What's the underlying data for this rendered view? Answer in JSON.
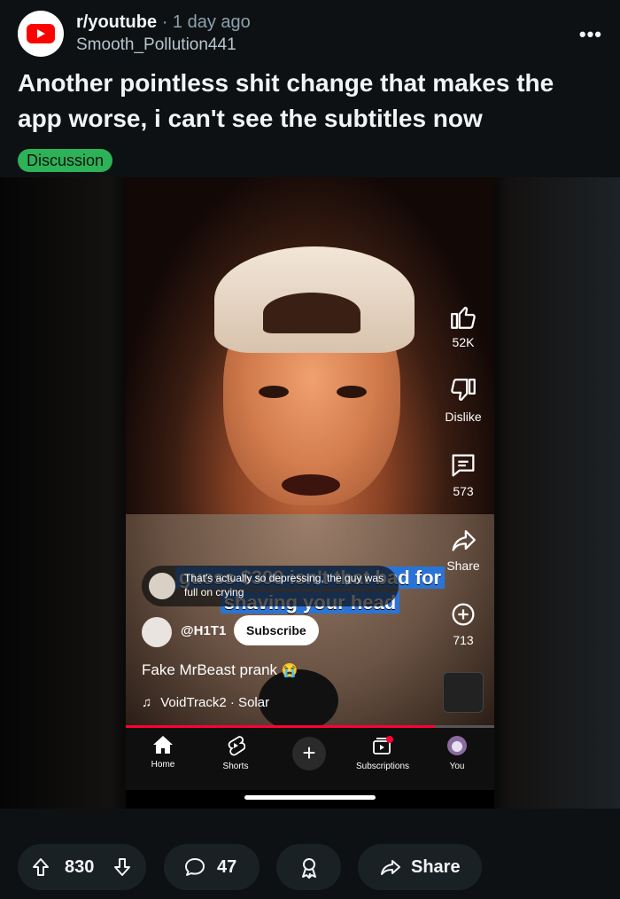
{
  "post": {
    "subreddit": "r/youtube",
    "separator": "·",
    "time": "1 day ago",
    "author": "Smooth_Pollution441",
    "more": "•••",
    "title": "Another pointless shit change that makes the app worse, i can't see the subtitles now",
    "flair": "Discussion"
  },
  "short": {
    "comment_popup": "That's actually so depressing, the guy was full on crying",
    "subtitle_line1": "guess $300 isn't that bad for",
    "subtitle_line2": "shaving your head",
    "like_count": "52K",
    "dislike_label": "Dislike",
    "comment_count": "573",
    "share_label": "Share",
    "remix_count": "713",
    "channel": "@H1T1",
    "subscribe_label": "Subscribe",
    "caption": "Fake MrBeast prank",
    "caption_emoji": "😭",
    "track": "VoidTrack2 · Solar",
    "progress": 0.84
  },
  "bottom_nav": {
    "home": "Home",
    "shorts": "Shorts",
    "create": "+",
    "subscriptions": "Subscriptions",
    "you": "You"
  },
  "actions": {
    "upvotes": "830",
    "comments": "47",
    "share": "Share"
  },
  "colors": {
    "background": "#0e1113",
    "flair": "#2db357",
    "youtube_red": "#ff0000",
    "subtitle_bg": "#2a74d8"
  }
}
